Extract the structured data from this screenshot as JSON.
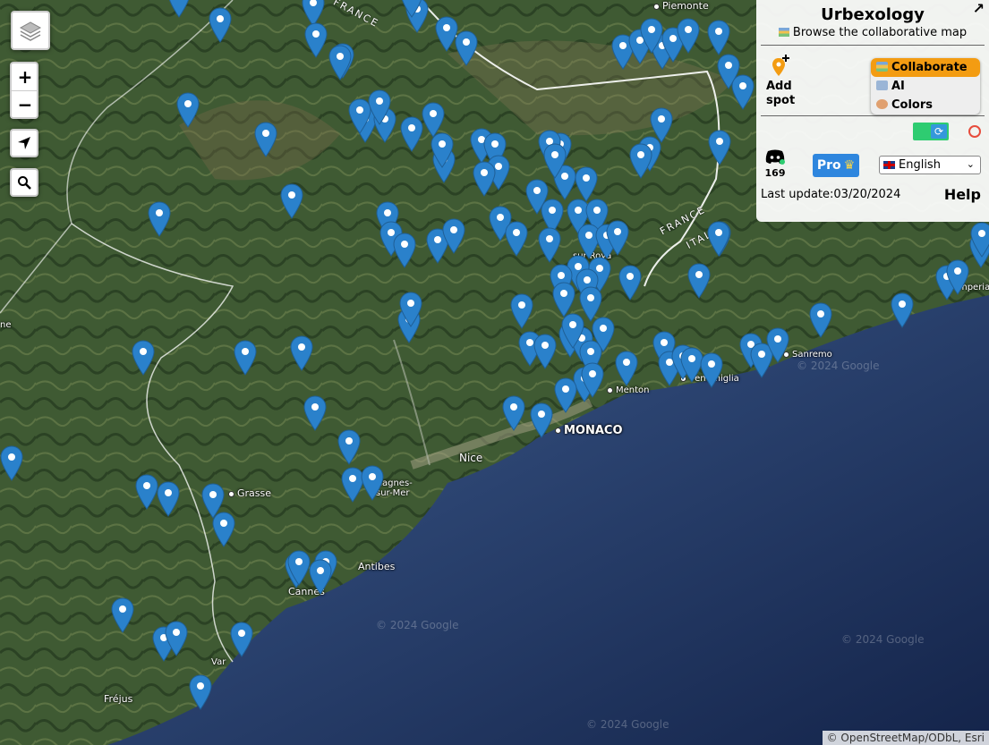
{
  "panel": {
    "title": "Urbexology",
    "subtitle": "Browse the collaborative map",
    "collapse_icon": "↗",
    "add_spot_label": "Add spot",
    "modes": [
      {
        "label": "Collaborate",
        "active": true
      },
      {
        "label": "AI",
        "active": false
      },
      {
        "label": "Colors",
        "active": false
      }
    ],
    "discord_count": "169",
    "pro_label": "Pro",
    "language": "English",
    "last_update_label": "Last update:",
    "last_update_value": "03/20/2024",
    "help_label": "Help"
  },
  "controls": {
    "zoom_in": "+",
    "zoom_out": "−"
  },
  "places": {
    "piemonte": "Piemonte",
    "monaco": "MONACO",
    "nice": "Nice",
    "grasse": "Grasse",
    "cagnes": "Cagnes-sur-Mer",
    "antibes": "Antibes",
    "cannes": "Cannes",
    "frejus": "Fréjus",
    "menton": "Menton",
    "ventimiglia": "Ventimiglia",
    "sanremo": "Sanremo",
    "imperia": "Imperia",
    "sur_roya": "sur-Roya",
    "var": "Var",
    "ne": "ne"
  },
  "border_labels": {
    "france_top": "FRANCE",
    "france_right": "FRANCE",
    "italia": "ITALIA"
  },
  "watermark": "© 2024 Google",
  "attribution": "© OpenStreetMap/ODbL, Esri"
}
